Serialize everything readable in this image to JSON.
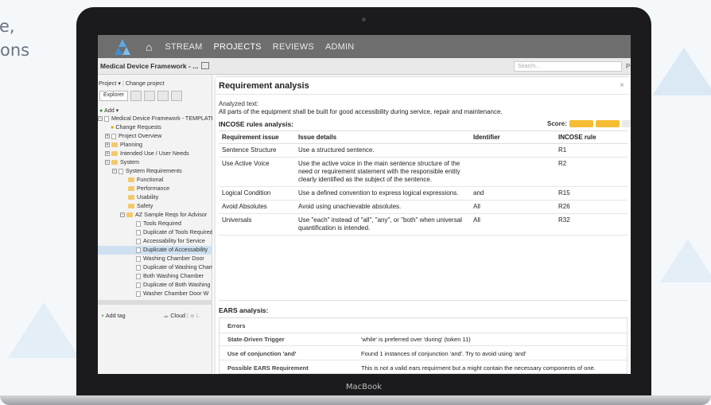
{
  "promo": {
    "line1": "e,",
    "line2": "ons"
  },
  "laptop": {
    "brand": "MacBook"
  },
  "nav": {
    "items": [
      "STREAM",
      "PROJECTS",
      "REVIEWS",
      "ADMIN"
    ]
  },
  "subbar": {
    "project_title": "Medical Device Framework - ...",
    "search_placeholder": "Search...",
    "extra": "P"
  },
  "sidebar": {
    "project_label": "Project ▾",
    "change_project": "Change project",
    "explorer_tab": "Explorer",
    "add_label": "Add ▾",
    "tree": [
      "Medical Device Framework - TEMPLATE",
      "Change Requests",
      "Project Overview",
      "Planning",
      "Intended Use / User Needs",
      "System",
      "System Requirements",
      "Functional",
      "Performance",
      "Usability",
      "Safety",
      "AZ Sample Reqs for Advisor",
      "Tools Required",
      "Duplicate of Tools Required",
      "Accessability for Service",
      "Duplicate of Accessability",
      "Washing Chamber Door",
      "Duplicate of Washing Chamber",
      "Both Washing Chamber",
      "Duplicate of Both Washing",
      "Washer Chamber Door W"
    ],
    "add_tag": "Add tag",
    "cloud": "Cloud"
  },
  "modal": {
    "title": "Requirement analysis",
    "close": "×",
    "analyzed_label": "Analyzed text:",
    "analyzed_text": "All parts of the equipment shall be built for good accessibility during service, repair and maintenance.",
    "incose_heading": "INCOSE rules analysis:",
    "score_label": "Score:",
    "score": {
      "filled": 2,
      "total": 3,
      "filled_color": "#f6bd34",
      "empty_color": "#e9e9e9"
    },
    "table": {
      "headers": [
        "Requirement issue",
        "Issue details",
        "Identifier",
        "INCOSE rule"
      ],
      "rows": [
        [
          "Sentence Structure",
          "Use a structured sentence.",
          "",
          "R1"
        ],
        [
          "Use Active Voice",
          "Use the active voice in the main sentence structure of the need or requirement statement with the responsible entity clearly identified as the subject of the sentence.",
          "",
          "R2"
        ],
        [
          "Logical Condition",
          "Use a defined convention to express logical expressions.",
          "and",
          "R15"
        ],
        [
          "Avoid Absolutes",
          "Avoid using unachievable absolutes.",
          "All",
          "R26"
        ],
        [
          "Universals",
          "Use \"each\" instead of \"all\", \"any\", or \"both\" when universal quantification is intended.",
          "All",
          "R32"
        ]
      ]
    },
    "ears_heading": "EARS analysis:",
    "ears_errors": "Errors",
    "ears_rows": [
      {
        "k": "State-Driven Trigger",
        "v": "'while' is preferred over 'during' (token 11)"
      },
      {
        "k": "Use of conjunction 'and'",
        "v": "Found 1 instances of conjunction 'and'. Try to avoid using 'and'"
      },
      {
        "k": "Possible EARS Requirement",
        "v": "This is not a valid ears requirment but a might contain the necessary components of one."
      }
    ]
  }
}
